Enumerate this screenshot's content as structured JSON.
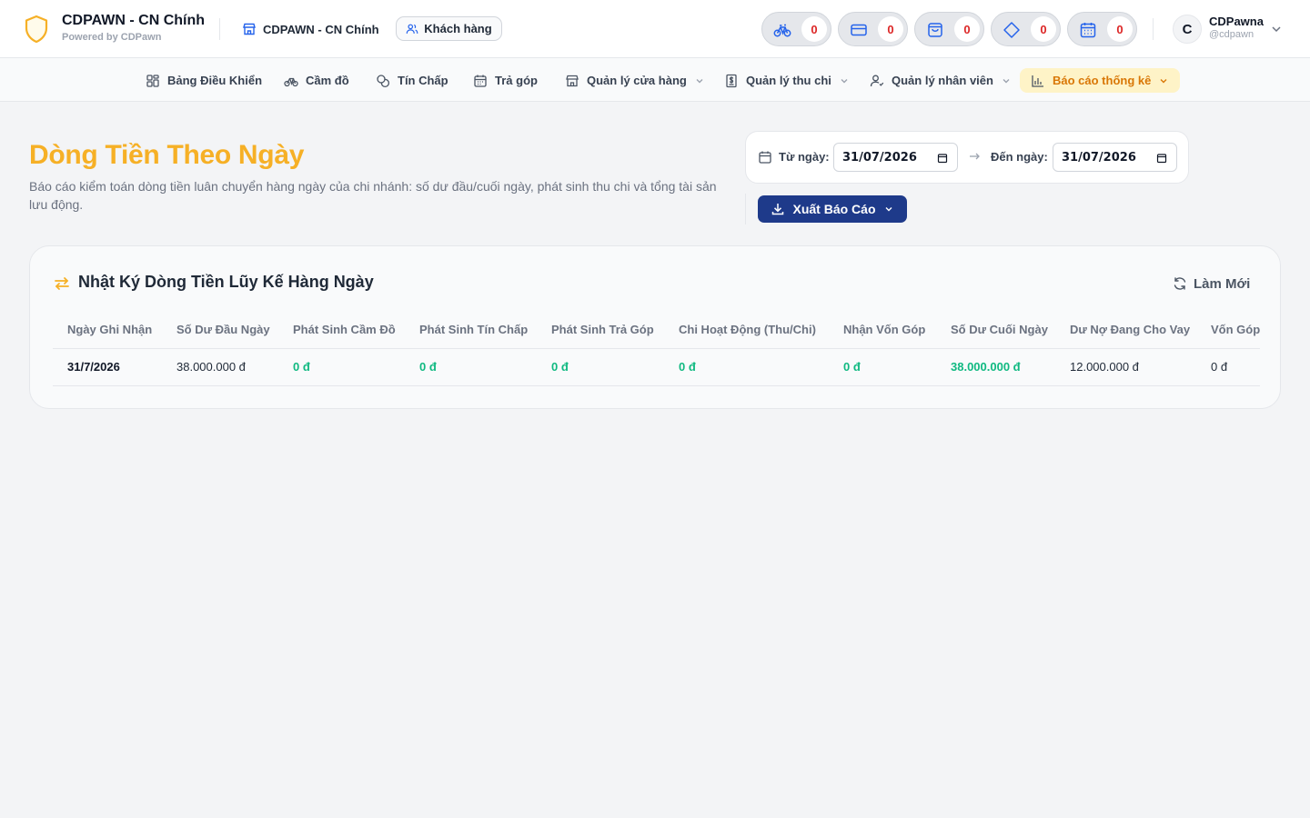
{
  "brand": {
    "title": "CDPAWN - CN Chính",
    "subtitle": "Powered by CDPawn"
  },
  "branch": {
    "label": "CDPAWN - CN Chính"
  },
  "customers": {
    "label": "Khách hàng"
  },
  "stats": [
    {
      "icon": "bicycle-icon",
      "count": "0"
    },
    {
      "icon": "card-icon",
      "count": "0"
    },
    {
      "icon": "shopping-bag-icon",
      "count": "0"
    },
    {
      "icon": "diamond-icon",
      "count": "0"
    },
    {
      "icon": "calendar-icon",
      "count": "0"
    }
  ],
  "user": {
    "initial": "C",
    "name": "CDPawna",
    "handle": "@cdpawn"
  },
  "nav": [
    {
      "label": "Bảng Điều Khiển",
      "icon": "dashboard-icon"
    },
    {
      "label": "Cầm đồ",
      "icon": "bicycle-icon"
    },
    {
      "label": "Tín Chấp",
      "icon": "coins-icon"
    },
    {
      "label": "Trả góp",
      "icon": "calendar-icon"
    },
    {
      "label": "Quản lý cửa hàng",
      "icon": "store-icon"
    },
    {
      "label": "Quản lý thu chi",
      "icon": "receipt-icon"
    },
    {
      "label": "Quản lý nhân viên",
      "icon": "user-icon"
    },
    {
      "label": "Báo cáo thống kê",
      "icon": "bar-chart-icon"
    }
  ],
  "page": {
    "title": "Dòng Tiền Theo Ngày",
    "description": "Báo cáo kiểm toán dòng tiền luân chuyển hàng ngày của chi nhánh: số dư đầu/cuối ngày, phát sinh thu chi và tổng tài sản lưu động."
  },
  "filter": {
    "from_label": "Từ ngày:",
    "from_value": "31/07/2026",
    "to_label": "Đến ngày:",
    "to_value": "31/07/2026",
    "export_label": "Xuất Báo Cáo"
  },
  "card": {
    "title": "Nhật Ký Dòng Tiền Lũy Kế Hàng Ngày",
    "refresh_label": "Làm Mới"
  },
  "table": {
    "headers": [
      "Ngày Ghi Nhận",
      "Số Dư Đầu Ngày",
      "Phát Sinh Cầm Đồ",
      "Phát Sinh Tín Chấp",
      "Phát Sinh Trả Góp",
      "Chi Hoạt Động (Thu/Chi)",
      "Nhận Vốn Góp",
      "Số Dư Cuối Ngày",
      "Dư Nợ Đang Cho Vay",
      "Vốn Góp"
    ],
    "rows": [
      [
        "31/7/2026",
        "38.000.000 đ",
        "0 đ",
        "0 đ",
        "0 đ",
        "0 đ",
        "0 đ",
        "38.000.000 đ",
        "12.000.000 đ",
        "0 đ"
      ]
    ]
  },
  "colors": {
    "accent": "#f6b026",
    "primary": "#1e3a8a",
    "positive": "#10b981",
    "badge": "#dc2626"
  }
}
